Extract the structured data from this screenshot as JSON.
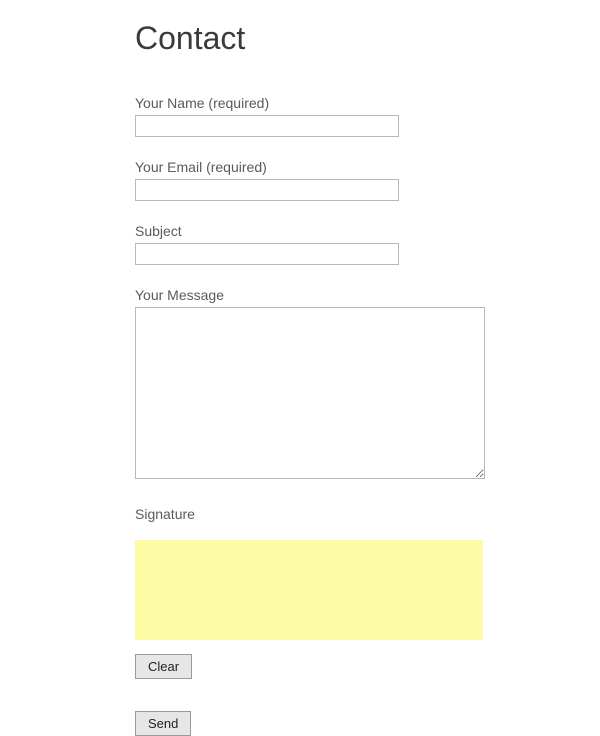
{
  "page": {
    "title": "Contact"
  },
  "form": {
    "name": {
      "label": "Your Name (required)",
      "value": ""
    },
    "email": {
      "label": "Your Email (required)",
      "value": ""
    },
    "subject": {
      "label": "Subject",
      "value": ""
    },
    "message": {
      "label": "Your Message",
      "value": ""
    },
    "signature": {
      "label": "Signature"
    },
    "clear_button_label": "Clear",
    "send_button_label": "Send"
  }
}
